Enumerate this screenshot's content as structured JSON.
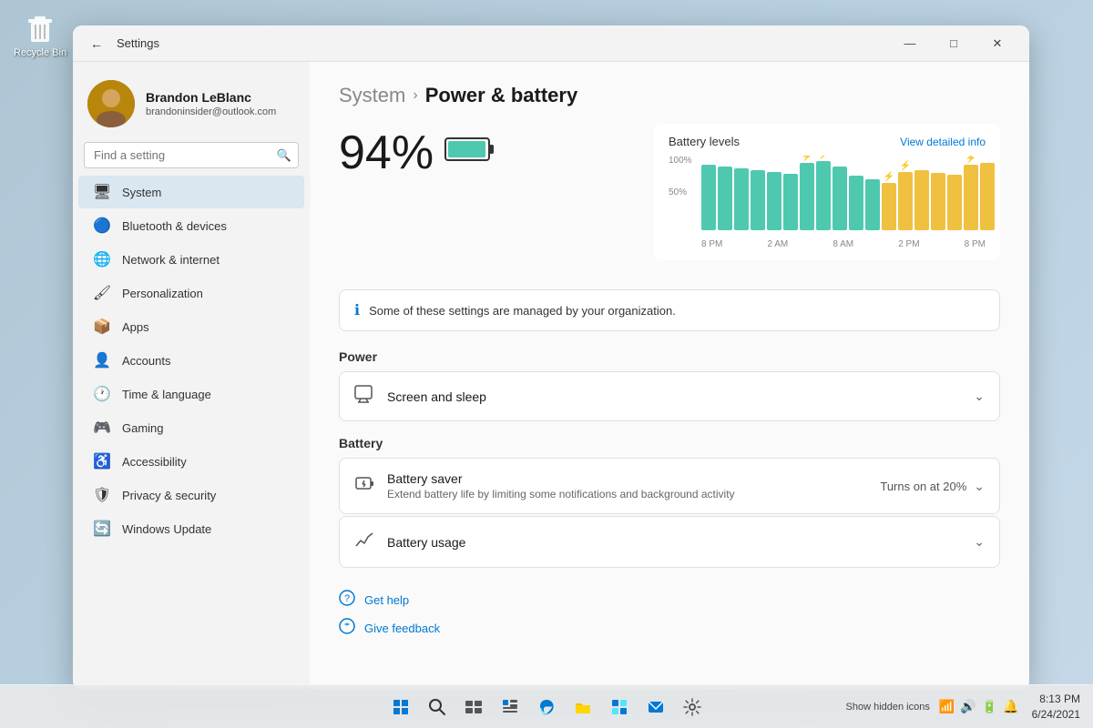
{
  "desktop": {
    "recycle_bin_label": "Recycle Bin"
  },
  "window": {
    "title": "Settings",
    "back_tooltip": "Back"
  },
  "window_controls": {
    "minimize": "—",
    "maximize": "□",
    "close": "✕"
  },
  "user": {
    "name": "Brandon LeBlanc",
    "email": "brandoninsider@outlook.com"
  },
  "search": {
    "placeholder": "Find a setting"
  },
  "nav_items": [
    {
      "id": "system",
      "label": "System",
      "icon": "🖥",
      "active": true
    },
    {
      "id": "bluetooth",
      "label": "Bluetooth & devices",
      "icon": "🔵",
      "active": false
    },
    {
      "id": "network",
      "label": "Network & internet",
      "icon": "🌐",
      "active": false
    },
    {
      "id": "personalization",
      "label": "Personalization",
      "icon": "🖌",
      "active": false
    },
    {
      "id": "apps",
      "label": "Apps",
      "icon": "📦",
      "active": false
    },
    {
      "id": "accounts",
      "label": "Accounts",
      "icon": "👤",
      "active": false
    },
    {
      "id": "time",
      "label": "Time & language",
      "icon": "🕐",
      "active": false
    },
    {
      "id": "gaming",
      "label": "Gaming",
      "icon": "🎮",
      "active": false
    },
    {
      "id": "accessibility",
      "label": "Accessibility",
      "icon": "♿",
      "active": false
    },
    {
      "id": "privacy",
      "label": "Privacy & security",
      "icon": "🛡",
      "active": false
    },
    {
      "id": "windows_update",
      "label": "Windows Update",
      "icon": "🔄",
      "active": false
    }
  ],
  "breadcrumb": {
    "system": "System",
    "arrow": "›",
    "current": "Power & battery"
  },
  "battery": {
    "percent": "94%",
    "icon": "🔋"
  },
  "chart": {
    "title": "Battery levels",
    "link": "View detailed info",
    "y_labels": [
      "100%",
      "50%"
    ],
    "x_labels": [
      "8 PM",
      "2 AM",
      "8 AM",
      "2 PM",
      "8 PM"
    ],
    "bars": [
      {
        "height": 90,
        "type": "teal"
      },
      {
        "height": 88,
        "type": "teal"
      },
      {
        "height": 85,
        "type": "teal"
      },
      {
        "height": 83,
        "type": "teal"
      },
      {
        "height": 80,
        "type": "teal"
      },
      {
        "height": 78,
        "type": "teal"
      },
      {
        "height": 92,
        "type": "teal",
        "charge": true
      },
      {
        "height": 95,
        "type": "teal",
        "charge": true
      },
      {
        "height": 88,
        "type": "teal"
      },
      {
        "height": 75,
        "type": "teal"
      },
      {
        "height": 70,
        "type": "teal"
      },
      {
        "height": 65,
        "type": "yellow",
        "charge": true
      },
      {
        "height": 80,
        "type": "yellow",
        "charge": true
      },
      {
        "height": 82,
        "type": "yellow"
      },
      {
        "height": 79,
        "type": "yellow"
      },
      {
        "height": 76,
        "type": "yellow"
      },
      {
        "height": 90,
        "type": "yellow",
        "charge": true
      },
      {
        "height": 92,
        "type": "yellow"
      }
    ]
  },
  "info_banner": {
    "text": "Some of these settings are managed by your organization."
  },
  "power_section": {
    "header": "Power",
    "screen_sleep": {
      "name": "Screen and sleep",
      "icon": "🖥"
    }
  },
  "battery_section": {
    "header": "Battery",
    "battery_saver": {
      "name": "Battery saver",
      "desc": "Extend battery life by limiting some notifications and background activity",
      "status": "Turns on at 20%",
      "icon": "🔋"
    },
    "battery_usage": {
      "name": "Battery usage",
      "icon": "📊"
    }
  },
  "footer": {
    "get_help": "Get help",
    "give_feedback": "Give feedback"
  },
  "taskbar": {
    "time": "8:13 PM",
    "date": "6/24/2021",
    "show_hidden": "Show hidden icons"
  }
}
